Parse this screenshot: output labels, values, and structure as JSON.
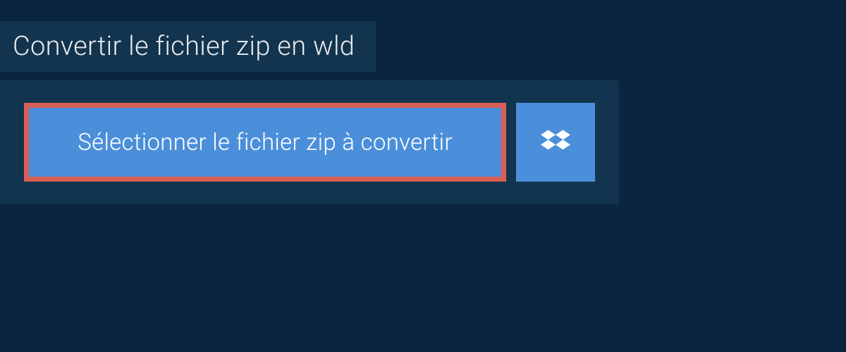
{
  "heading": "Convertir le fichier zip en wld",
  "select_button_label": "Sélectionner le fichier zip à convertir",
  "colors": {
    "page_bg": "#0a2540",
    "panel_bg": "#12344e",
    "button_bg": "#4b8fda",
    "highlight_border": "#d95f55",
    "text_light": "#e8eaed",
    "text_white": "#ffffff"
  }
}
